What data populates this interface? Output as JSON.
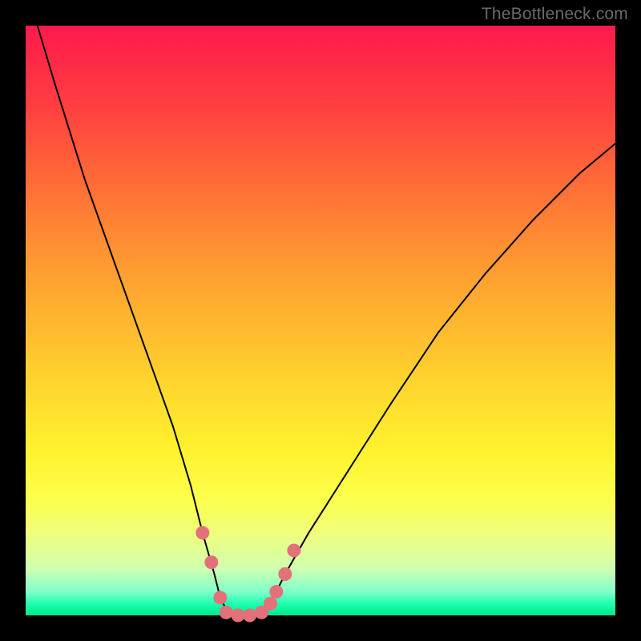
{
  "watermark": "TheBottleneck.com",
  "chart_data": {
    "type": "line",
    "title": "",
    "xlabel": "",
    "ylabel": "",
    "xlim": [
      0,
      100
    ],
    "ylim": [
      0,
      100
    ],
    "grid": false,
    "legend": false,
    "series": [
      {
        "name": "curve",
        "color": "#000000",
        "x": [
          2,
          5,
          10,
          15,
          20,
          25,
          28,
          30,
          32,
          33,
          34,
          36,
          38,
          40,
          42,
          44,
          48,
          55,
          62,
          70,
          78,
          86,
          94,
          100
        ],
        "values": [
          100,
          90,
          74,
          60,
          46,
          32,
          22,
          14,
          7,
          3,
          1,
          0,
          0,
          1,
          3,
          7,
          14,
          25,
          36,
          48,
          58,
          67,
          75,
          80
        ]
      }
    ],
    "markers": {
      "name": "highlight-points",
      "color": "#e2717a",
      "x": [
        30,
        31.5,
        33,
        34,
        36,
        38,
        40,
        41.5,
        42.5,
        44,
        45.5
      ],
      "y": [
        14,
        9,
        3,
        0.5,
        0,
        0,
        0.5,
        2,
        4,
        7,
        11
      ]
    }
  }
}
